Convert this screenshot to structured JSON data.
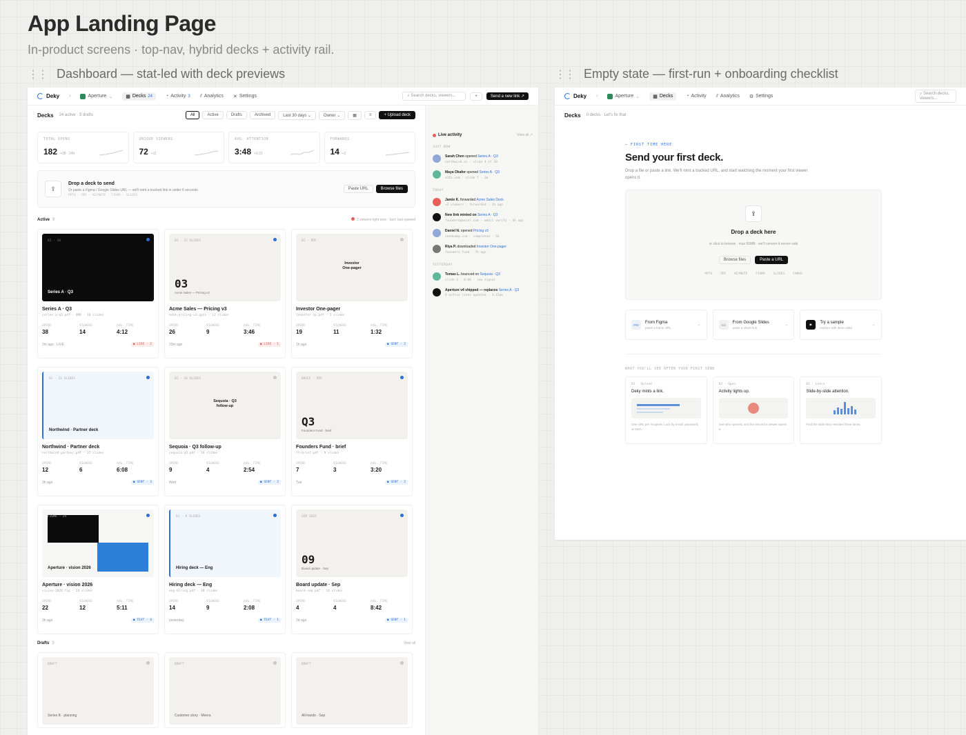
{
  "page": {
    "title": "App Landing Page",
    "subtitle": "In-product screens · top-nav, hybrid decks + activity rail."
  },
  "frames": {
    "dashboard_label": "Dashboard — stat-led with deck previews",
    "empty_label": "Empty state — first-run + onboarding checklist"
  },
  "nav": {
    "brand": "Deky",
    "workspace": "Aperture",
    "items": [
      {
        "label": "Decks",
        "count": "24"
      },
      {
        "label": "Activity",
        "count": "3"
      },
      {
        "label": "Analytics"
      },
      {
        "label": "Settings"
      }
    ],
    "search_placeholder": "Search decks, viewers...",
    "cta": "Send a new link ↗"
  },
  "decks_bar": {
    "title": "Decks",
    "meta": "24 active · 3 drafts",
    "filters": [
      "All",
      "Active",
      "Drafts",
      "Archived"
    ],
    "range": "Last 30 days ⌄",
    "owner": "Owner ⌄",
    "upload": "+ Upload deck"
  },
  "stats": [
    {
      "label": "TOTAL OPENS",
      "value": "182",
      "delta": "+38 · 24h"
    },
    {
      "label": "UNIQUE VIEWERS",
      "value": "72",
      "delta": "+11"
    },
    {
      "label": "AVG. ATTENTION",
      "value": "3:48",
      "delta": "+0:22"
    },
    {
      "label": "FORWARDS",
      "value": "14",
      "delta": "+2"
    }
  ],
  "dropzone": {
    "title": "Drop a deck to send",
    "desc": "Or paste a Figma / Google Slides URL — we'll mint a tracked link in under 6 seconds",
    "formats": "PPTX · PDF · KEYNOTE · FIGMA · SLIDES",
    "paste": "Paste URL",
    "browse": "Browse files"
  },
  "active": {
    "label": "Active",
    "count": "9",
    "right": "2 viewers right now · Sort: last opened"
  },
  "metric_labels": {
    "opens": "OPENS",
    "viewers": "VIEWERS",
    "avg": "AVG. TIME"
  },
  "cards": [
    {
      "name": "Series A · Q3",
      "file": "series-a-q3.pdf · 4MB · 18 slides",
      "thumb_tag": "01 · 18",
      "thumb_title": "Series A · Q3",
      "opens": "38",
      "viewers": "14",
      "avg": "4:12",
      "when": "2m ago · LIVE",
      "status": "● LIVE · 2",
      "style": "dark"
    },
    {
      "name": "Acme Sales — Pricing v3",
      "file": "acme-pricing-v3.pptx · 12 slides",
      "thumb_tag": "03 · 12 SLIDES",
      "big": "03",
      "big_sub": "Acme Sales — Pricing v3",
      "opens": "26",
      "viewers": "9",
      "avg": "3:46",
      "when": "23m ago",
      "status": "● LIVE · 1",
      "style": "beige"
    },
    {
      "name": "Investor One-pager",
      "file": "investor-1p.pdf · 1 slides",
      "thumb_tag": "01 · PDF",
      "center": "Investor\nOne-pager",
      "opens": "19",
      "viewers": "11",
      "avg": "1:32",
      "when": "1h ago",
      "status": "● SENT · 2",
      "style": "beige-plain"
    },
    {
      "name": "Northwind · Partner deck",
      "file": "northwind-partner.pdf · 22 slides",
      "thumb_tag": "02 · 22 SLIDES",
      "thumb_title": "Northwind · Partner deck",
      "opens": "12",
      "viewers": "6",
      "avg": "6:08",
      "when": "3h ago",
      "status": "● SENT · 3",
      "style": "blue"
    },
    {
      "name": "Sequoia · Q3 follow-up",
      "file": "sequoia-q3.pdf · 16 slides",
      "thumb_tag": "01 · 16 SLIDES",
      "center": "Sequoia · Q3\nfollow-up",
      "opens": "9",
      "viewers": "4",
      "avg": "2:54",
      "when": "Wed",
      "status": "● SENT · 2",
      "style": "beige-plain"
    },
    {
      "name": "Founders Fund · brief",
      "file": "ff-brief.pdf · 9 slides",
      "thumb_tag": "BRIEF · PDF",
      "big": "Q3",
      "big_sub": "Founders Fund · brief",
      "opens": "7",
      "viewers": "3",
      "avg": "3:20",
      "when": "Tue",
      "status": "● SENT · 2",
      "style": "beige"
    },
    {
      "name": "Aperture · vision 2026",
      "file": "vision-2026.fig · 24 slides",
      "thumb_tag": "FIGMA · 24",
      "thumb_title": "Aperture · vision 2026",
      "opens": "22",
      "viewers": "12",
      "avg": "5:11",
      "when": "3h ago",
      "status": "● TEXT · 4",
      "style": "split"
    },
    {
      "name": "Hiring deck — Eng",
      "file": "eng-hiring.pdf · 10 slides",
      "thumb_tag": "01 · 9 SLIDES",
      "thumb_title": "Hiring deck — Eng",
      "opens": "14",
      "viewers": "9",
      "avg": "2:08",
      "when": "yesterday",
      "status": "● TEXT · 1",
      "style": "blue"
    },
    {
      "name": "Board update · Sep",
      "file": "board-sep.pdf · 14 slides",
      "thumb_tag": "SEP 2025",
      "big": "09",
      "big_sub": "Board update · Sep",
      "opens": "4",
      "viewers": "4",
      "avg": "8:42",
      "when": "2d ago",
      "status": "● SENT · 1",
      "style": "beige"
    }
  ],
  "drafts": {
    "label": "Drafts",
    "count": "3",
    "right": "View all",
    "items": [
      {
        "tag": "DRAFT",
        "title": "Series B · planning"
      },
      {
        "tag": "DRAFT",
        "title": "Customer story · Meera"
      },
      {
        "tag": "DRAFT",
        "title": "All-hands · Sep"
      }
    ]
  },
  "rail": {
    "title": "Live activity",
    "right": "View all ↗",
    "groups": [
      {
        "label": "JUST NOW",
        "items": [
          {
            "who": "Sarah Chen",
            "verb": "opened",
            "target": "Series A · Q3",
            "sub": "northwind.vc · slide 4 of 18",
            "color": "#8fa8d8"
          },
          {
            "who": "Maya Okafor",
            "verb": "opened",
            "target": "Series A · Q3",
            "sub": "a16z.com · slide 7 · 3m",
            "color": "#5fb89a"
          }
        ]
      },
      {
        "label": "TODAY",
        "items": [
          {
            "who": "Jamie K.",
            "verb": "forwarded",
            "target": "Acme Sales Deck",
            "sub": "+2 viewers · forwarded · 2h ago",
            "color": "#e6605a"
          },
          {
            "who": "New link minted on",
            "verb": "",
            "target": "Series A · Q3",
            "sub": "founders@accel.com · email verify · 4h ago",
            "color": "#111111"
          },
          {
            "who": "Daniel N.",
            "verb": "opened",
            "target": "Pricing v3",
            "sub": "seedcamp.com · completed · 5h",
            "color": "#8fa8d8"
          },
          {
            "who": "Riya P.",
            "verb": "downloaded",
            "target": "Investor One-pager",
            "sub": "founders.fund · 7h ago",
            "color": "#777777"
          }
        ]
      },
      {
        "label": "YESTERDAY",
        "items": [
          {
            "who": "Tomas L.",
            "verb": "bounced on",
            "target": "Sequoia · Q3",
            "sub": "slide 3 · 0:08 · low signal",
            "color": "#5fb89a"
          },
          {
            "who": "Aperture v4 shipped — replaces",
            "verb": "",
            "target": "Series A · Q3",
            "sub": "4 active links updated · 3:15pm",
            "color": "#111111"
          }
        ]
      }
    ]
  },
  "empty": {
    "decks_title": "Decks",
    "decks_meta": "0 decks · Let's fix that",
    "kicker": "— FIRST TIME HERE",
    "title": "Send your first deck.",
    "desc": "Drop a file or paste a link. We'll mint a tracked URL, and start watching the moment your first viewer opens it.",
    "drop_title": "Drop a deck here",
    "drop_sub": "or click to browse · max 50MB · we'll convert it server-side",
    "browse": "Browse files",
    "paste": "Paste a URL",
    "formats": [
      "PPTX",
      "PDF",
      "KEYNOTE",
      "FIGMA",
      "SLIDES",
      "CANVA"
    ],
    "sources": [
      {
        "icon": "FIG",
        "title": "From Figma",
        "desc": "paste a frame URL"
      },
      {
        "icon": "GS",
        "title": "From Google Slides",
        "desc": "paste a share link"
      },
      {
        "icon": "▶",
        "title": "Try a sample",
        "desc": "explore with demo data"
      }
    ],
    "next_label": "WHAT YOU'LL SEE AFTER YOUR FIRST SEND",
    "steps": [
      {
        "k": "01 · Upload",
        "t": "Deky mints a link.",
        "d": "One URL per recipient. Lock by email, password, or NDA."
      },
      {
        "k": "02 · Open",
        "t": "Activity lights up.",
        "d": "See who opened, and the second a viewer opens it."
      },
      {
        "k": "03 · Learn",
        "t": "Slide-by-slide attention.",
        "d": "Find the slide they revisited three times."
      }
    ]
  }
}
